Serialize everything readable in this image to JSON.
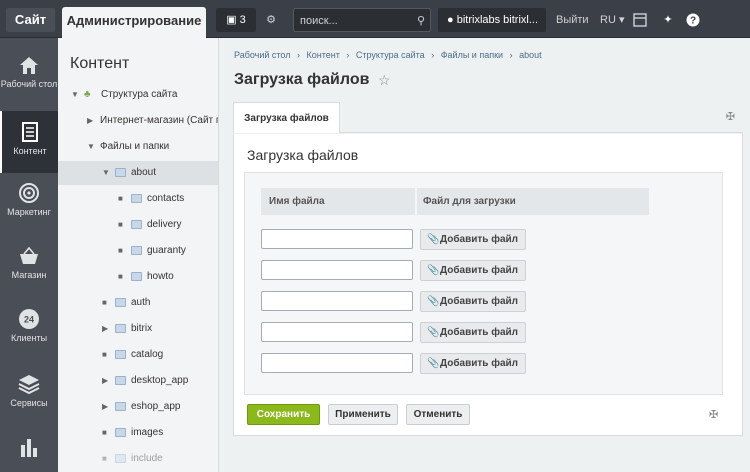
{
  "topbar": {
    "site_tab": "Сайт",
    "admin_tab": "Администрирование",
    "notifications_count": "3",
    "search_placeholder": "поиск...",
    "user": "bitrixlabs bitrixl...",
    "logout": "Выйти",
    "language": "RU"
  },
  "leftnav": {
    "items": [
      {
        "label": "Рабочий стол",
        "icon": "home-icon"
      },
      {
        "label": "Контент",
        "icon": "document-icon"
      },
      {
        "label": "Маркетинг",
        "icon": "target-icon"
      },
      {
        "label": "Магазин",
        "icon": "basket-icon"
      },
      {
        "label": "Клиенты",
        "icon": "24-clients-icon"
      },
      {
        "label": "Сервисы",
        "icon": "layers-icon"
      },
      {
        "label": "",
        "icon": "bar-chart-icon"
      }
    ]
  },
  "tree": {
    "title": "Контент",
    "items": [
      {
        "label": "Структура сайта"
      },
      {
        "label": "Интернет-магазин (Сайт по"
      },
      {
        "label": "Файлы и папки"
      },
      {
        "label": "about"
      },
      {
        "label": "contacts"
      },
      {
        "label": "delivery"
      },
      {
        "label": "guaranty"
      },
      {
        "label": "howto"
      },
      {
        "label": "auth"
      },
      {
        "label": "bitrix"
      },
      {
        "label": "catalog"
      },
      {
        "label": "desktop_app"
      },
      {
        "label": "eshop_app"
      },
      {
        "label": "images"
      },
      {
        "label": "include"
      }
    ]
  },
  "breadcrumbs": [
    "Рабочий стол",
    "Контент",
    "Структура сайта",
    "Файлы и папки",
    "about"
  ],
  "breadcrumb_separator": "›",
  "page_title": "Загрузка файлов",
  "tab_label": "Загрузка файлов",
  "form": {
    "title": "Загрузка файлов",
    "col_name": "Имя файла",
    "col_file": "Файл для загрузки",
    "add_file_label": "Добавить файл",
    "rows": [
      {
        "name": ""
      },
      {
        "name": ""
      },
      {
        "name": ""
      },
      {
        "name": ""
      },
      {
        "name": ""
      }
    ]
  },
  "buttons": {
    "save": "Сохранить",
    "apply": "Применить",
    "cancel": "Отменить"
  },
  "colors": {
    "topbar": "#3b3f47",
    "sidebar": "#4a4f57",
    "save_green": "#8bb91b"
  }
}
